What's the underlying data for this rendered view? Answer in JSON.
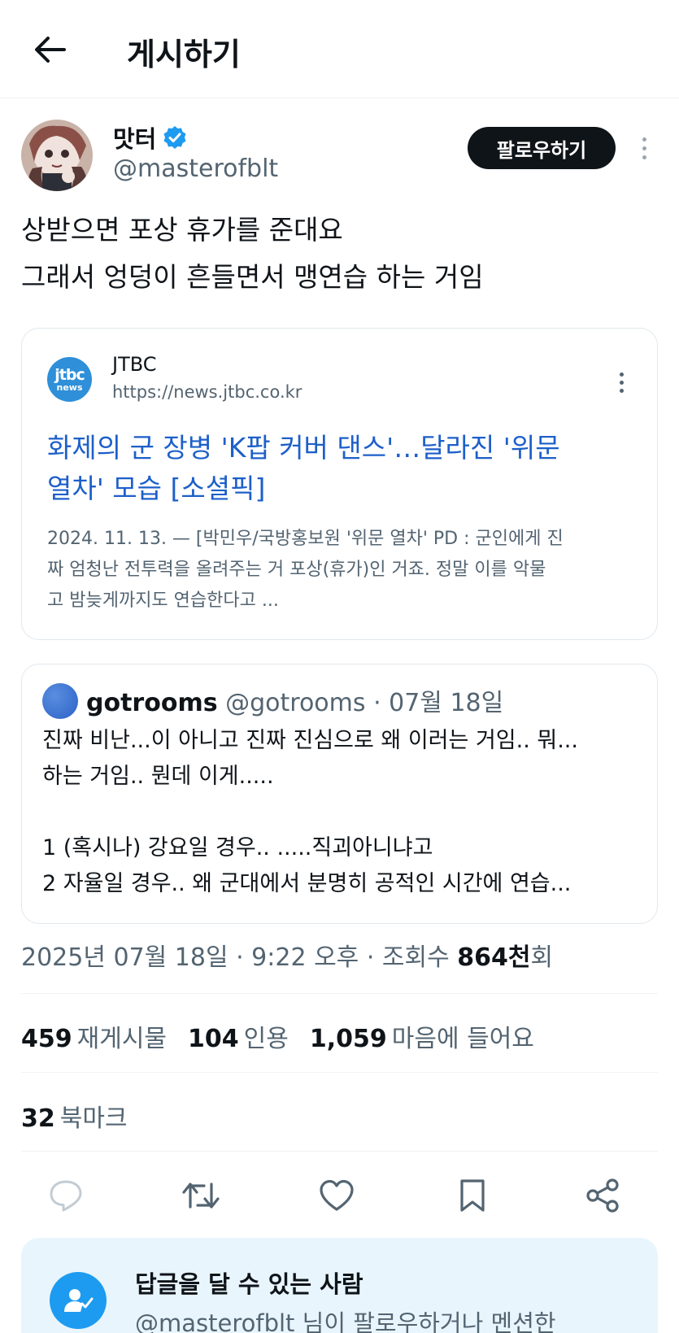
{
  "header": {
    "title": "게시하기",
    "back_icon": "arrow-left-icon"
  },
  "author": {
    "name": "맛터",
    "handle": "@masterofblt",
    "verified": true,
    "follow_label": "팔로우하기"
  },
  "tweet": {
    "lines": [
      "상받으면 포상 휴가를 준대요",
      "그래서 엉덩이 흔들면서 맹연습 하는 거임"
    ]
  },
  "link_card": {
    "logo_line1": "jtbc",
    "logo_line2": "news",
    "source": "JTBC",
    "url": "https://news.jtbc.co.kr",
    "title_lines": [
      "화제의 군 장병 'K팝 커버 댄스'…달라진 '위문",
      "열차' 모습 [소셜픽]"
    ],
    "desc_lines": [
      "2024. 11. 13. — [박민우/국방홍보원 '위문 열차' PD : 군인에게 진",
      "짜 엄청난 전투력을 올려주는 거 포상(휴가)인 거죠. 정말 이를 악물",
      "고 밤늦게까지도 연습한다고 ..."
    ],
    "title_color": "#1d5fc9"
  },
  "quote": {
    "name": "gotrooms",
    "handle": "@gotrooms",
    "date": "· 07월 18일",
    "lines": [
      "진짜 비난...이 아니고 진짜 진심으로 왜 이러는 거임.. 뭐...",
      "하는 거임.. 뭔데 이게.....",
      "",
      "1 (혹시나) 강요일 경우.. .....직괴아니냐고",
      "2 자율일 경우.. 왜 군대에서 분명히 공적인 시간에 연습..."
    ]
  },
  "meta": {
    "datetime": "2025년 07월 18일 · 9:22 오후 · 조회수 ",
    "views": "864천",
    "views_suffix": "회"
  },
  "stats": {
    "reposts_count": "459",
    "reposts_label": "재게시물",
    "quotes_count": "104",
    "quotes_label": "인용",
    "likes_count": "1,059",
    "likes_label": "마음에 들어요",
    "bookmarks_count": "32",
    "bookmarks_label": "북마크"
  },
  "actions": [
    "reply-icon",
    "repost-icon",
    "like-icon",
    "bookmark-icon",
    "share-icon"
  ],
  "reply_restriction": {
    "title": "답글을 달 수 있는 사람",
    "subtitle": "@masterofblt 님이 팔로우하거나 멘션한"
  },
  "colors": {
    "accent": "#1d9bf0",
    "text": "#0f1419",
    "muted": "#536471",
    "link": "#1d5fc9"
  }
}
